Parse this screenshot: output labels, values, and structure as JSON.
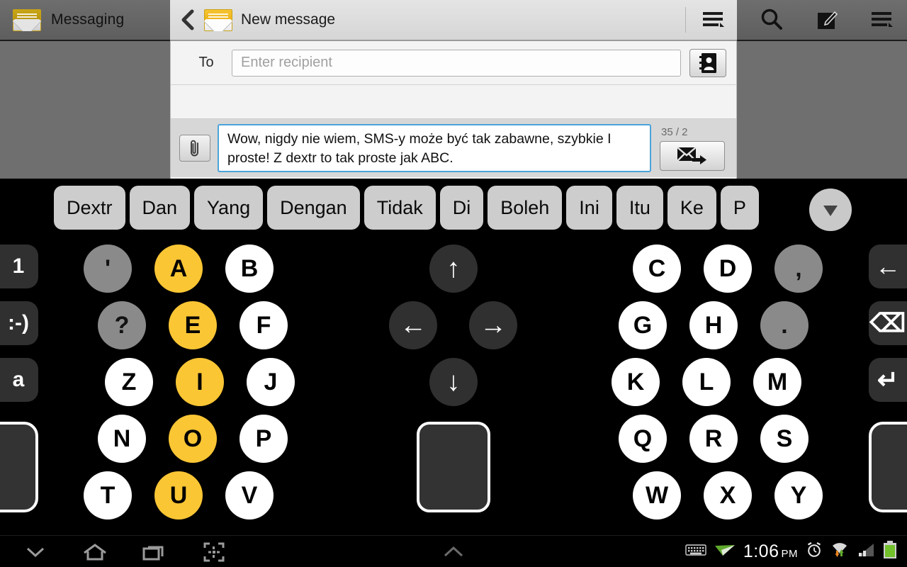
{
  "topbar": {
    "app_name": "Messaging",
    "page_title": "New message",
    "back_icon": "back-chevron-icon",
    "mail_icon": "envelope-icon",
    "menu_icon": "menu-list-icon",
    "search_icon": "search-icon",
    "compose_icon": "compose-icon",
    "overflow_icon": "menu-list-icon"
  },
  "compose": {
    "to_label": "To",
    "recipient_value": "",
    "recipient_placeholder": "Enter recipient",
    "contacts_icon": "contact-book-icon",
    "attach_icon": "paperclip-icon",
    "message_text": "Wow, nigdy nie wiem, SMS-y może być tak zabawne, szybkie I proste! Z dextr to tak proste jak ABC.",
    "char_count": "35 / 2",
    "send_icon": "send-message-icon"
  },
  "keyboard": {
    "suggestions": [
      "Dextr",
      "Dan",
      "Yang",
      "Dengan",
      "Tidak",
      "Di",
      "Boleh",
      "Ini",
      "Itu",
      "Ke",
      "P"
    ],
    "more_icon": "chevron-down-icon",
    "left_edge_keys": [
      {
        "label": "1",
        "name": "numbers-key"
      },
      {
        "label": ":-)",
        "name": "emoticon-key"
      },
      {
        "label": "a",
        "name": "lowercase-key"
      }
    ],
    "right_edge_keys": [
      {
        "label": "←",
        "name": "tab-left-key"
      },
      {
        "label": "⌫",
        "name": "backspace-key"
      },
      {
        "label": "↵",
        "name": "enter-key"
      }
    ],
    "left_shift_name": "left-shift-key",
    "right_shift_name": "right-shift-key",
    "space_name": "space-key",
    "letters": [
      {
        "label": "'",
        "type": "punct"
      },
      {
        "label": "A",
        "type": "vowel"
      },
      {
        "label": "B",
        "type": "letter"
      },
      {
        "label": "C",
        "type": "letter"
      },
      {
        "label": "D",
        "type": "letter"
      },
      {
        "label": ",",
        "type": "punct"
      },
      {
        "label": "?",
        "type": "punct"
      },
      {
        "label": "E",
        "type": "vowel"
      },
      {
        "label": "F",
        "type": "letter"
      },
      {
        "label": "G",
        "type": "letter"
      },
      {
        "label": "H",
        "type": "letter"
      },
      {
        "label": ".",
        "type": "punct"
      },
      {
        "label": "Z",
        "type": "letter"
      },
      {
        "label": "I",
        "type": "vowel"
      },
      {
        "label": "J",
        "type": "letter"
      },
      {
        "label": "K",
        "type": "letter"
      },
      {
        "label": "L",
        "type": "letter"
      },
      {
        "label": "M",
        "type": "letter"
      },
      {
        "label": "N",
        "type": "letter"
      },
      {
        "label": "O",
        "type": "vowel"
      },
      {
        "label": "P",
        "type": "letter"
      },
      {
        "label": "Q",
        "type": "letter"
      },
      {
        "label": "R",
        "type": "letter"
      },
      {
        "label": "S",
        "type": "letter"
      },
      {
        "label": "T",
        "type": "letter"
      },
      {
        "label": "U",
        "type": "vowel"
      },
      {
        "label": "V",
        "type": "letter"
      },
      {
        "label": "W",
        "type": "letter"
      },
      {
        "label": "X",
        "type": "letter"
      },
      {
        "label": "Y",
        "type": "letter"
      }
    ],
    "nav_keys": [
      {
        "label": "↑",
        "name": "cursor-up-key"
      },
      {
        "label": "←",
        "name": "cursor-left-key"
      },
      {
        "label": "→",
        "name": "cursor-right-key"
      },
      {
        "label": "↓",
        "name": "cursor-down-key"
      }
    ]
  },
  "navbar": {
    "hide_keyboard_icon": "chevron-down-icon",
    "home_icon": "home-icon",
    "recents_icon": "recent-apps-icon",
    "screenshot_icon": "screen-capture-icon",
    "expand_icon": "chevron-up-icon"
  },
  "statusbar": {
    "keyboard_icon": "keyboard-icon",
    "location_icon": "location-arrow-icon",
    "time": "1:06",
    "ampm": "PM",
    "alarm_icon": "alarm-clock-icon",
    "wifi_icon": "wifi-icon",
    "signal_icon": "cellular-signal-icon",
    "battery_icon": "battery-icon"
  },
  "colors": {
    "vowel_highlight": "#fbc634",
    "textbox_focus": "#4ba3d9",
    "battery_green": "#72c02c",
    "keyboard_bg": "#000000"
  }
}
